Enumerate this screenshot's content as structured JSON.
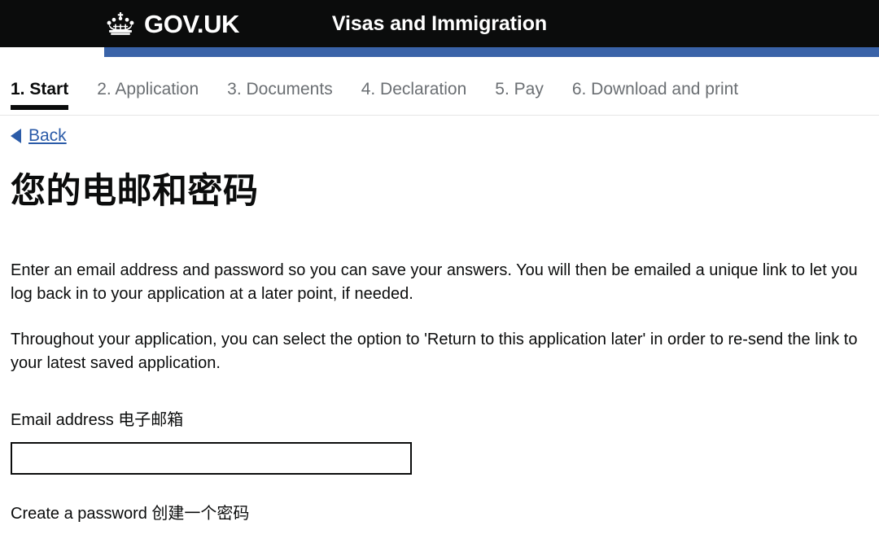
{
  "header": {
    "brand_name": "GOV.UK",
    "crown_icon": "crown-icon",
    "service_name": "Visas and Immigration",
    "background_color": "#0b0c0c",
    "accent_bar_color": "#3a63a8"
  },
  "step_nav": {
    "steps": [
      {
        "label": "1. Start",
        "active": true
      },
      {
        "label": "2. Application",
        "active": false
      },
      {
        "label": "3. Documents",
        "active": false
      },
      {
        "label": "4. Declaration",
        "active": false
      },
      {
        "label": "5. Pay",
        "active": false
      },
      {
        "label": "6. Download and print",
        "active": false
      }
    ]
  },
  "back": {
    "label": "Back",
    "arrow_icon": "triangle-left-icon",
    "link_color": "#2b5ba8"
  },
  "main": {
    "heading": "您的电邮和密码",
    "paragraph_1": "Enter an email address and password so you can save your answers. You will then be emailed a unique link to let you log back in to your application at a later point, if needed.",
    "paragraph_2": "Throughout your application, you can select the option to 'Return to this application later' in order to re-send the link to your latest saved application."
  },
  "form": {
    "email_label": "Email address 电子邮箱",
    "email_value": "",
    "email_placeholder": "",
    "password_label": "Create a password 创建一个密码"
  }
}
